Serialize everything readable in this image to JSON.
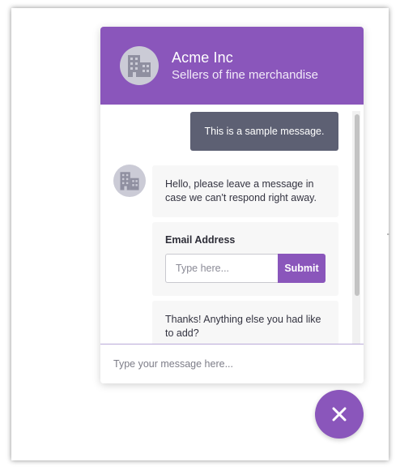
{
  "colors": {
    "brand": "#8a56bb",
    "outgoing_bubble": "#5d6073",
    "incoming_bubble": "#f7f7f7",
    "avatar_bg": "#cbcbd6",
    "avatar_icon": "#8f8fa0"
  },
  "header": {
    "company_name": "Acme Inc",
    "tagline": "Sellers of fine merchandise",
    "avatar_icon": "building-icon"
  },
  "messages": {
    "outgoing": "This is a sample message.",
    "greeting": "Hello, please leave a message in case we can't respond right away.",
    "followup": "Thanks! Anything else you had like to add?"
  },
  "email_form": {
    "label": "Email Address",
    "placeholder": "Type here...",
    "submit_label": "Submit"
  },
  "composer": {
    "placeholder": "Type your message here..."
  },
  "launcher": {
    "icon": "close-icon"
  }
}
